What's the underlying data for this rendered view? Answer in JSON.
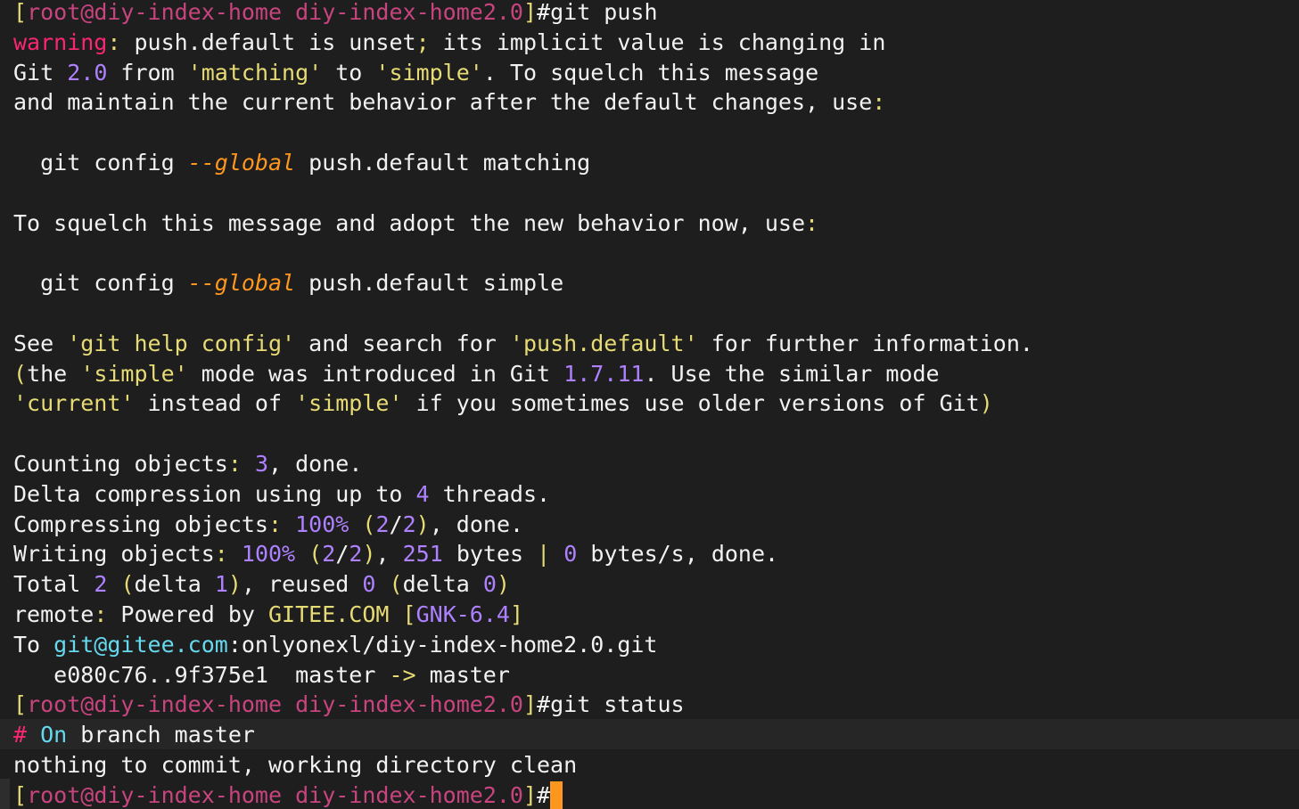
{
  "colors": {
    "background": "#1e1e1e",
    "text": "#f2f2f2",
    "yellow": "#e6db74",
    "red": "#f92672",
    "magenta": "#c8447f",
    "purple": "#ae81ff",
    "cyan": "#66d9ef",
    "orange": "#fd971f",
    "cursor": "#fd971f"
  },
  "terminal": {
    "lines": [
      [
        [
          "y",
          "["
        ],
        [
          "m",
          "root@diy-index-home"
        ],
        [
          "w",
          " "
        ],
        [
          "m",
          "diy-index-home2.0"
        ],
        [
          "y",
          "]"
        ],
        [
          "w",
          "#git push"
        ]
      ],
      [
        [
          "r",
          "warning"
        ],
        [
          "y",
          ":"
        ],
        [
          "w",
          " push.default is unset"
        ],
        [
          "y",
          ";"
        ],
        [
          "w",
          " its implicit value is changing in"
        ]
      ],
      [
        [
          "w",
          "Git "
        ],
        [
          "p",
          "2.0"
        ],
        [
          "w",
          " from "
        ],
        [
          "y",
          "'matching'"
        ],
        [
          "w",
          " to "
        ],
        [
          "y",
          "'simple'"
        ],
        [
          "w",
          ". To squelch this message"
        ]
      ],
      [
        [
          "w",
          "and maintain the current behavior after the default changes, use"
        ],
        [
          "y",
          ":"
        ]
      ],
      [],
      [
        [
          "w",
          "  git config "
        ],
        [
          "o",
          "--global"
        ],
        [
          "w",
          " push.default matching"
        ]
      ],
      [],
      [
        [
          "w",
          "To squelch this message and adopt the new behavior now, use"
        ],
        [
          "y",
          ":"
        ]
      ],
      [],
      [
        [
          "w",
          "  git config "
        ],
        [
          "o",
          "--global"
        ],
        [
          "w",
          " push.default simple"
        ]
      ],
      [],
      [
        [
          "w",
          "See "
        ],
        [
          "y",
          "'git help config'"
        ],
        [
          "w",
          " and search for "
        ],
        [
          "y",
          "'push.default'"
        ],
        [
          "w",
          " for further information."
        ]
      ],
      [
        [
          "y",
          "("
        ],
        [
          "w",
          "the "
        ],
        [
          "y",
          "'simple'"
        ],
        [
          "w",
          " mode was introduced in Git "
        ],
        [
          "p",
          "1.7.11"
        ],
        [
          "w",
          ". Use the similar mode"
        ]
      ],
      [
        [
          "y",
          "'current'"
        ],
        [
          "w",
          " instead of "
        ],
        [
          "y",
          "'simple'"
        ],
        [
          "w",
          " if you sometimes use older versions of Git"
        ],
        [
          "y",
          ")"
        ]
      ],
      [],
      [
        [
          "w",
          "Counting objects"
        ],
        [
          "y",
          ":"
        ],
        [
          "w",
          " "
        ],
        [
          "p",
          "3"
        ],
        [
          "w",
          ", done."
        ]
      ],
      [
        [
          "w",
          "Delta compression using up to "
        ],
        [
          "p",
          "4"
        ],
        [
          "w",
          " threads."
        ]
      ],
      [
        [
          "w",
          "Compressing objects"
        ],
        [
          "y",
          ":"
        ],
        [
          "w",
          " "
        ],
        [
          "p",
          "100%"
        ],
        [
          "w",
          " "
        ],
        [
          "y",
          "("
        ],
        [
          "p",
          "2"
        ],
        [
          "w",
          "/"
        ],
        [
          "p",
          "2"
        ],
        [
          "y",
          ")"
        ],
        [
          "w",
          ", done."
        ]
      ],
      [
        [
          "w",
          "Writing objects"
        ],
        [
          "y",
          ":"
        ],
        [
          "w",
          " "
        ],
        [
          "p",
          "100%"
        ],
        [
          "w",
          " "
        ],
        [
          "y",
          "("
        ],
        [
          "p",
          "2"
        ],
        [
          "w",
          "/"
        ],
        [
          "p",
          "2"
        ],
        [
          "y",
          ")"
        ],
        [
          "w",
          ", "
        ],
        [
          "p",
          "251"
        ],
        [
          "w",
          " bytes "
        ],
        [
          "y",
          "|"
        ],
        [
          "w",
          " "
        ],
        [
          "p",
          "0"
        ],
        [
          "w",
          " bytes/s, done."
        ]
      ],
      [
        [
          "w",
          "Total "
        ],
        [
          "p",
          "2"
        ],
        [
          "w",
          " "
        ],
        [
          "y",
          "("
        ],
        [
          "w",
          "delta "
        ],
        [
          "p",
          "1"
        ],
        [
          "y",
          ")"
        ],
        [
          "w",
          ", reused "
        ],
        [
          "p",
          "0"
        ],
        [
          "w",
          " "
        ],
        [
          "y",
          "("
        ],
        [
          "w",
          "delta "
        ],
        [
          "p",
          "0"
        ],
        [
          "y",
          ")"
        ]
      ],
      [
        [
          "w",
          "remote"
        ],
        [
          "y",
          ":"
        ],
        [
          "w",
          " Powered by "
        ],
        [
          "y",
          "GITEE.COM"
        ],
        [
          "w",
          " "
        ],
        [
          "y",
          "["
        ],
        [
          "p",
          "GNK-6.4"
        ],
        [
          "y",
          "]"
        ]
      ],
      [
        [
          "w",
          "To "
        ],
        [
          "c",
          "git@gitee.com"
        ],
        [
          "w",
          ":onlyonexl/diy-index-home2.0.git"
        ]
      ],
      [
        [
          "w",
          "   e080c76..9f375e1  master "
        ],
        [
          "y",
          "->"
        ],
        [
          "w",
          " master"
        ]
      ],
      [
        [
          "y",
          "["
        ],
        [
          "m",
          "root@diy-index-home"
        ],
        [
          "w",
          " "
        ],
        [
          "m",
          "diy-index-home2.0"
        ],
        [
          "y",
          "]"
        ],
        [
          "w",
          "#git status"
        ]
      ],
      [
        [
          "r",
          "#"
        ],
        [
          "w",
          " "
        ],
        [
          "c",
          "On"
        ],
        [
          "w",
          " branch master"
        ]
      ],
      [
        [
          "w",
          "nothing to commit, working directory clean"
        ]
      ],
      [
        [
          "y",
          "["
        ],
        [
          "m",
          "root@diy-index-home"
        ],
        [
          "w",
          " "
        ],
        [
          "m",
          "diy-index-home2.0"
        ],
        [
          "y",
          "]"
        ],
        [
          "w",
          "#"
        ]
      ]
    ]
  }
}
